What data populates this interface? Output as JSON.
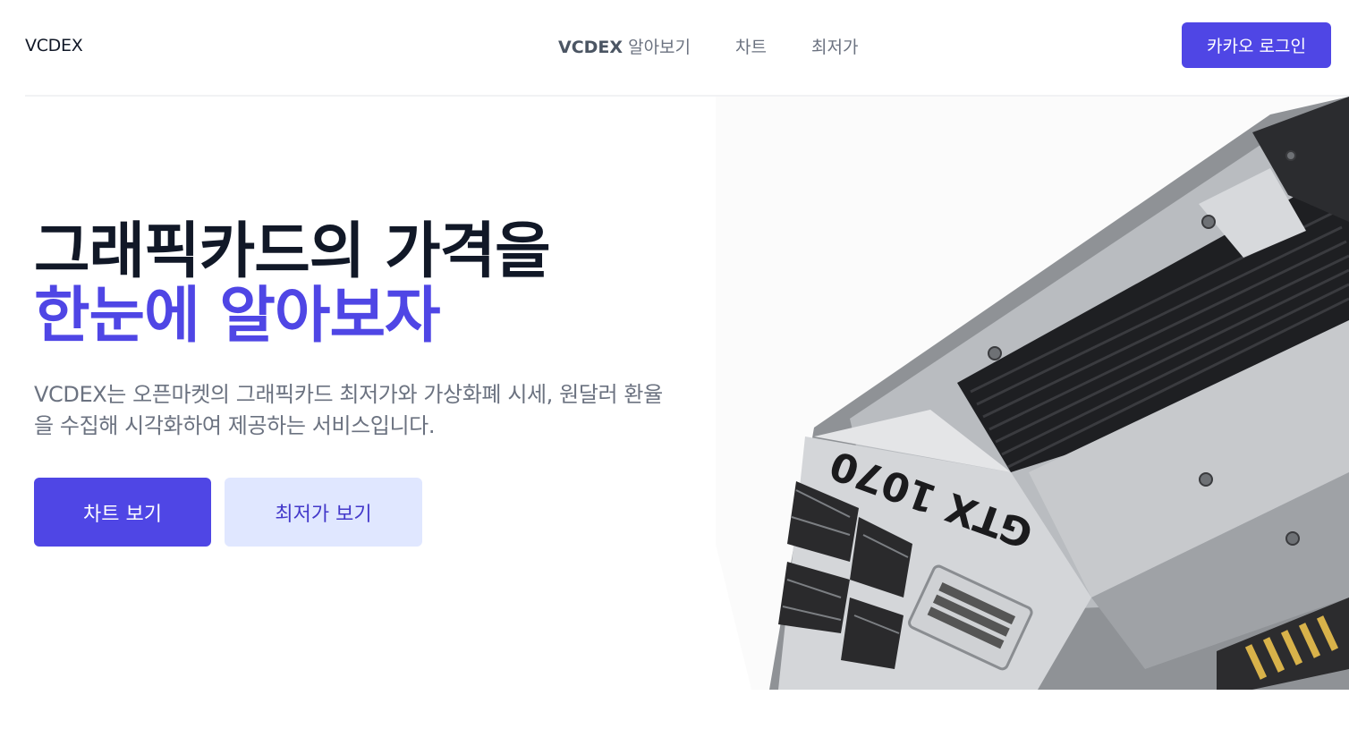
{
  "header": {
    "logo": "VCDEX",
    "nav": {
      "about_brand": "VCDEX",
      "about_suffix": " 알아보기",
      "chart": "차트",
      "lowest": "최저가"
    },
    "login_label": "카카오 로그인"
  },
  "hero": {
    "title_line1": "그래픽카드의 가격을",
    "title_line2": "한눈에 알아보자",
    "description": "VCDEX는 오픈마켓의 그래픽카드 최저가와 가상화폐 시세, 원달러 환율을 수집해 시각화하여 제공하는 서비스입니다.",
    "btn_chart": "차트 보기",
    "btn_lowest": "최저가 보기"
  },
  "image": {
    "gpu_label": "GTX 1070"
  },
  "colors": {
    "accent": "#4f46e5",
    "accent_light": "#e0e7ff",
    "text_dark": "#111827",
    "text_muted": "#6b7280"
  }
}
